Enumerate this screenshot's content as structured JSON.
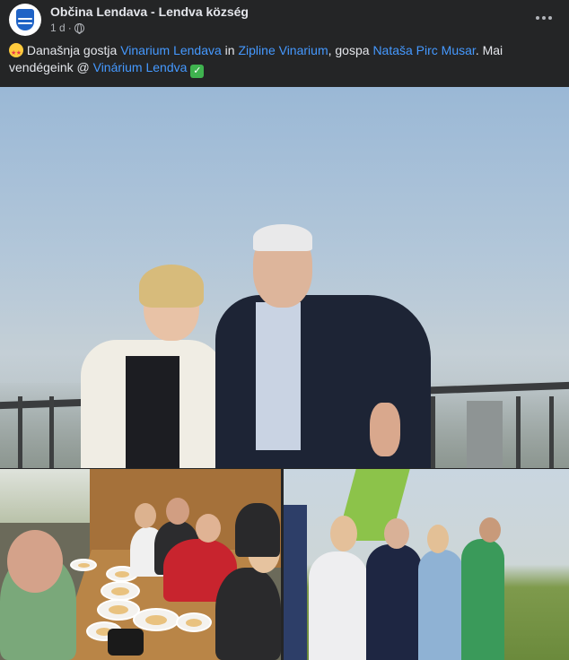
{
  "post": {
    "page_name": "Občina Lendava - Lendva község",
    "time": "1 d",
    "separator": "·",
    "text": {
      "part1": " Današnja gostja ",
      "link1": "Vinarium Lendava",
      "part2": " in ",
      "link2": "Zipline Vinarium",
      "part3": ", gospa ",
      "link3": "Nataša Pirc Musar",
      "part4": ". Mai vendégeink @ ",
      "link4": "Vinárium Lendva",
      "part5": " "
    }
  },
  "icons": {
    "avatar": "municipality-crest",
    "privacy": "globe-icon",
    "more": "more-options-icon",
    "emoji_start": "star-struck-emoji",
    "emoji_end": "check-mark-emoji"
  },
  "colors": {
    "background": "#242526",
    "text": "#e4e6eb",
    "secondary_text": "#b0b3b8",
    "link": "#4599ff"
  }
}
